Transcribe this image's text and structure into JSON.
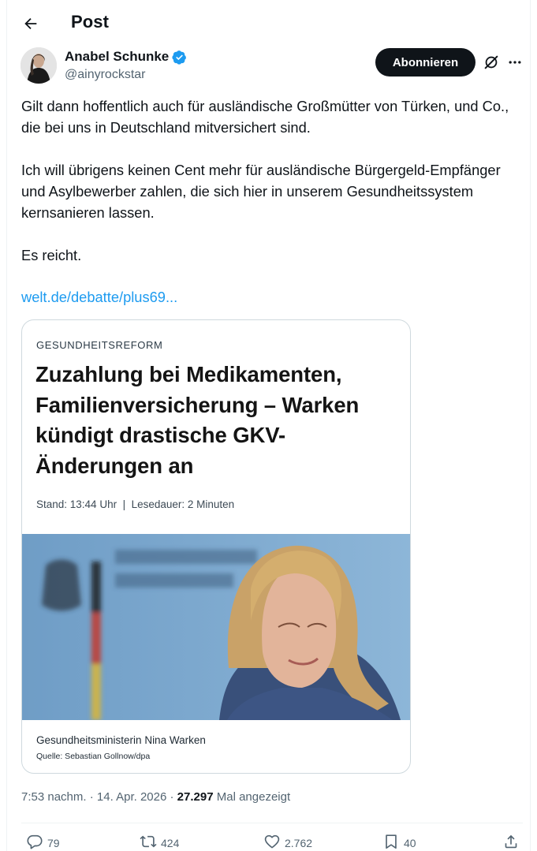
{
  "header": {
    "title": "Post"
  },
  "author": {
    "name": "Anabel Schunke",
    "handle": "@ainyrockstar",
    "follow_label": "Abonnieren"
  },
  "tweet": {
    "paragraphs": [
      "Gilt dann hoffentlich auch für ausländische Großmütter von Türken, und Co., die bei uns in Deutschland mitversichert sind.",
      "Ich will übrigens keinen Cent mehr für ausländische Bürgergeld-Empfänger und Asylbewerber zahlen, die sich hier in unserem Gesundheitssystem kernsanieren lassen.",
      "Es reicht."
    ],
    "link": "welt.de/debatte/plus69..."
  },
  "card": {
    "kicker": "GESUNDHEITSREFORM",
    "headline": "Zuzahlung bei Medikamenten, Familienversicherung – Warken kündigt drastische GKV-Änderungen an",
    "meta": "Stand: 13:44 Uhr  |  Lesedauer: 2 Minuten",
    "caption": "Gesundheitsministerin Nina Warken",
    "source": "Quelle: Sebastian Gollnow/dpa"
  },
  "post_meta": {
    "time": "7:53 nachm.",
    "date": "14. Apr. 2026",
    "views": "27.297",
    "views_label": "Mal angezeigt",
    "dot": "·"
  },
  "actions": {
    "replies": "79",
    "reposts": "424",
    "likes": "2.762",
    "bookmarks": "40"
  },
  "icons": {
    "back": "arrow-left-icon",
    "verified": "verified-badge-icon",
    "grok": "grok-icon",
    "more": "more-dots-icon",
    "reply": "reply-icon",
    "repost": "repost-icon",
    "like": "heart-icon",
    "bookmark": "bookmark-icon",
    "share": "share-icon"
  },
  "colors": {
    "link": "#1d9bf0",
    "verified": "#1d9bf0",
    "follow_bg": "#0f1419",
    "secondary_text": "#536471"
  }
}
